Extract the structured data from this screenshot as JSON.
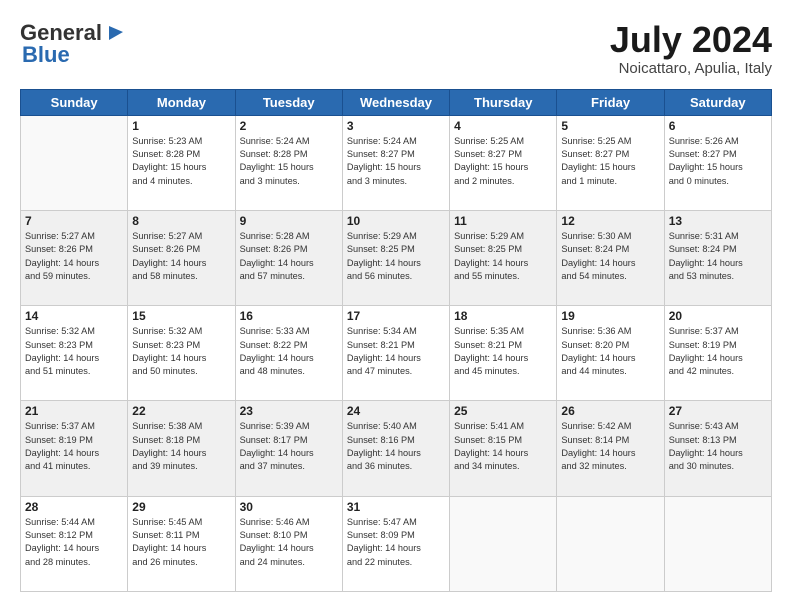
{
  "header": {
    "logo_general": "General",
    "logo_blue": "Blue",
    "month_title": "July 2024",
    "location": "Noicattaro, Apulia, Italy"
  },
  "calendar": {
    "days_of_week": [
      "Sunday",
      "Monday",
      "Tuesday",
      "Wednesday",
      "Thursday",
      "Friday",
      "Saturday"
    ],
    "weeks": [
      [
        {
          "day": "",
          "info": ""
        },
        {
          "day": "1",
          "info": "Sunrise: 5:23 AM\nSunset: 8:28 PM\nDaylight: 15 hours\nand 4 minutes."
        },
        {
          "day": "2",
          "info": "Sunrise: 5:24 AM\nSunset: 8:28 PM\nDaylight: 15 hours\nand 3 minutes."
        },
        {
          "day": "3",
          "info": "Sunrise: 5:24 AM\nSunset: 8:27 PM\nDaylight: 15 hours\nand 3 minutes."
        },
        {
          "day": "4",
          "info": "Sunrise: 5:25 AM\nSunset: 8:27 PM\nDaylight: 15 hours\nand 2 minutes."
        },
        {
          "day": "5",
          "info": "Sunrise: 5:25 AM\nSunset: 8:27 PM\nDaylight: 15 hours\nand 1 minute."
        },
        {
          "day": "6",
          "info": "Sunrise: 5:26 AM\nSunset: 8:27 PM\nDaylight: 15 hours\nand 0 minutes."
        }
      ],
      [
        {
          "day": "7",
          "info": "Sunrise: 5:27 AM\nSunset: 8:26 PM\nDaylight: 14 hours\nand 59 minutes."
        },
        {
          "day": "8",
          "info": "Sunrise: 5:27 AM\nSunset: 8:26 PM\nDaylight: 14 hours\nand 58 minutes."
        },
        {
          "day": "9",
          "info": "Sunrise: 5:28 AM\nSunset: 8:26 PM\nDaylight: 14 hours\nand 57 minutes."
        },
        {
          "day": "10",
          "info": "Sunrise: 5:29 AM\nSunset: 8:25 PM\nDaylight: 14 hours\nand 56 minutes."
        },
        {
          "day": "11",
          "info": "Sunrise: 5:29 AM\nSunset: 8:25 PM\nDaylight: 14 hours\nand 55 minutes."
        },
        {
          "day": "12",
          "info": "Sunrise: 5:30 AM\nSunset: 8:24 PM\nDaylight: 14 hours\nand 54 minutes."
        },
        {
          "day": "13",
          "info": "Sunrise: 5:31 AM\nSunset: 8:24 PM\nDaylight: 14 hours\nand 53 minutes."
        }
      ],
      [
        {
          "day": "14",
          "info": "Sunrise: 5:32 AM\nSunset: 8:23 PM\nDaylight: 14 hours\nand 51 minutes."
        },
        {
          "day": "15",
          "info": "Sunrise: 5:32 AM\nSunset: 8:23 PM\nDaylight: 14 hours\nand 50 minutes."
        },
        {
          "day": "16",
          "info": "Sunrise: 5:33 AM\nSunset: 8:22 PM\nDaylight: 14 hours\nand 48 minutes."
        },
        {
          "day": "17",
          "info": "Sunrise: 5:34 AM\nSunset: 8:21 PM\nDaylight: 14 hours\nand 47 minutes."
        },
        {
          "day": "18",
          "info": "Sunrise: 5:35 AM\nSunset: 8:21 PM\nDaylight: 14 hours\nand 45 minutes."
        },
        {
          "day": "19",
          "info": "Sunrise: 5:36 AM\nSunset: 8:20 PM\nDaylight: 14 hours\nand 44 minutes."
        },
        {
          "day": "20",
          "info": "Sunrise: 5:37 AM\nSunset: 8:19 PM\nDaylight: 14 hours\nand 42 minutes."
        }
      ],
      [
        {
          "day": "21",
          "info": "Sunrise: 5:37 AM\nSunset: 8:19 PM\nDaylight: 14 hours\nand 41 minutes."
        },
        {
          "day": "22",
          "info": "Sunrise: 5:38 AM\nSunset: 8:18 PM\nDaylight: 14 hours\nand 39 minutes."
        },
        {
          "day": "23",
          "info": "Sunrise: 5:39 AM\nSunset: 8:17 PM\nDaylight: 14 hours\nand 37 minutes."
        },
        {
          "day": "24",
          "info": "Sunrise: 5:40 AM\nSunset: 8:16 PM\nDaylight: 14 hours\nand 36 minutes."
        },
        {
          "day": "25",
          "info": "Sunrise: 5:41 AM\nSunset: 8:15 PM\nDaylight: 14 hours\nand 34 minutes."
        },
        {
          "day": "26",
          "info": "Sunrise: 5:42 AM\nSunset: 8:14 PM\nDaylight: 14 hours\nand 32 minutes."
        },
        {
          "day": "27",
          "info": "Sunrise: 5:43 AM\nSunset: 8:13 PM\nDaylight: 14 hours\nand 30 minutes."
        }
      ],
      [
        {
          "day": "28",
          "info": "Sunrise: 5:44 AM\nSunset: 8:12 PM\nDaylight: 14 hours\nand 28 minutes."
        },
        {
          "day": "29",
          "info": "Sunrise: 5:45 AM\nSunset: 8:11 PM\nDaylight: 14 hours\nand 26 minutes."
        },
        {
          "day": "30",
          "info": "Sunrise: 5:46 AM\nSunset: 8:10 PM\nDaylight: 14 hours\nand 24 minutes."
        },
        {
          "day": "31",
          "info": "Sunrise: 5:47 AM\nSunset: 8:09 PM\nDaylight: 14 hours\nand 22 minutes."
        },
        {
          "day": "",
          "info": ""
        },
        {
          "day": "",
          "info": ""
        },
        {
          "day": "",
          "info": ""
        }
      ]
    ]
  }
}
